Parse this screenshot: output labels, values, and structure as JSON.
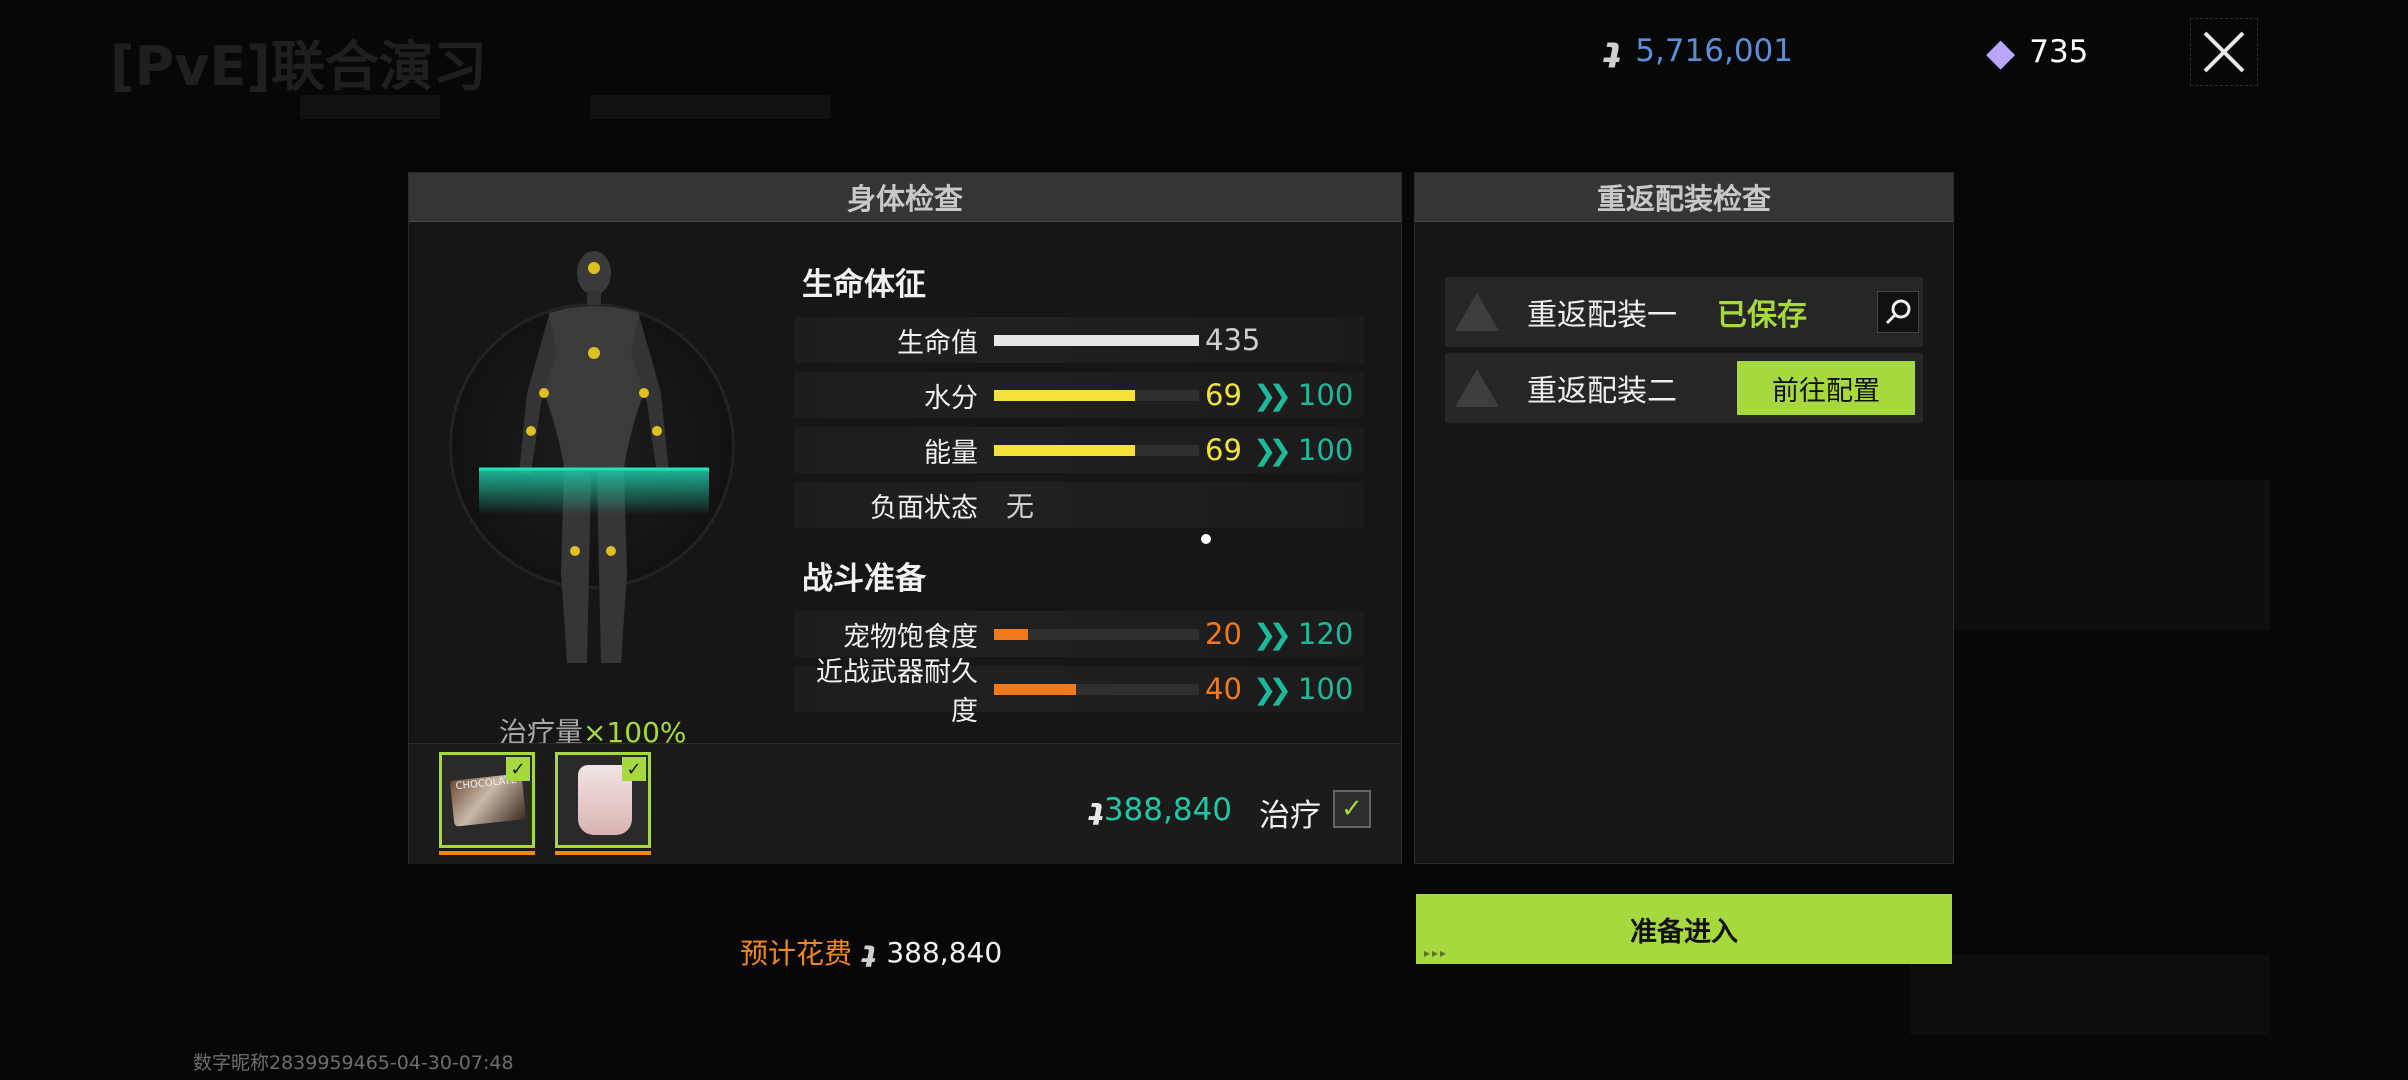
{
  "bg_title": "[PvE]联合演习",
  "top": {
    "coins": "5,716,001",
    "gems": "735",
    "colors": {
      "coins": "#5b8fd6",
      "gems": "#ffffff"
    },
    "icons": [
      "coin-icon",
      "gem-icon",
      "close-icon"
    ]
  },
  "body_check": {
    "header": "身体检查",
    "heal_rate_prefix": "治疗量",
    "heal_rate_mult": "×",
    "heal_rate_value": "100%",
    "vitals_title": "生命体征",
    "stats": [
      {
        "label": "生命值",
        "value": "435",
        "fill": 1.0,
        "color": "#e6e6e6",
        "max": ""
      },
      {
        "label": "水分",
        "value": "69",
        "fill": 0.69,
        "color": "#f2e23a",
        "max": "100"
      },
      {
        "label": "能量",
        "value": "69",
        "fill": 0.69,
        "color": "#f2e23a",
        "max": "100"
      }
    ],
    "negative_label": "负面状态",
    "negative_value": "无",
    "combat_title": "战斗准备",
    "combat": [
      {
        "label": "宠物饱食度",
        "value": "20",
        "fill": 0.1667,
        "color": "#f07a1c",
        "max": "120"
      },
      {
        "label": "近战武器耐久度",
        "value": "40",
        "fill": 0.4,
        "color": "#f07a1c",
        "max": "100"
      }
    ],
    "heal_cost": "388,840",
    "heal_label": "治疗",
    "items": [
      {
        "name": "chocolate",
        "label": "CHOCOLATE",
        "checked": true
      },
      {
        "name": "yogurt",
        "label": "",
        "checked": true
      }
    ]
  },
  "loadout_check": {
    "header": "重返配装检查",
    "rows": [
      {
        "name": "重返配装一",
        "status": "已保存"
      },
      {
        "name": "重返配装二",
        "action": "前往配置"
      }
    ]
  },
  "estimate": {
    "label": "预计花费",
    "value": "388,840"
  },
  "enter_button": "准备进入",
  "watermark": "数字昵称2839959465-04-30-07:48"
}
